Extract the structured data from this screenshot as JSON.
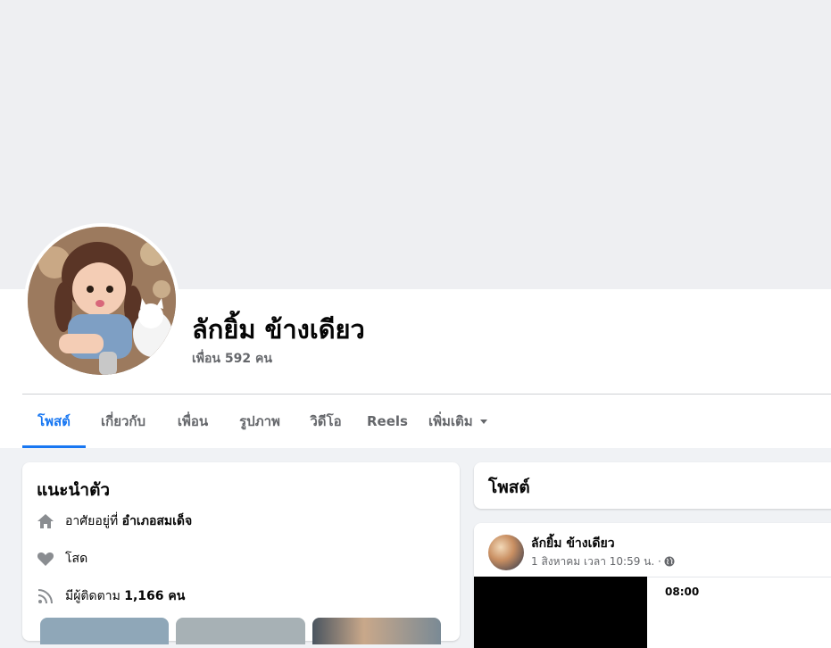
{
  "profile": {
    "name": "ลักยิ้ม ข้างเดียว",
    "friends": "เพื่อน 592 คน"
  },
  "tabs": [
    {
      "label": "โพสต์",
      "active": true
    },
    {
      "label": "เกี่ยวกับ",
      "active": false
    },
    {
      "label": "เพื่อน",
      "active": false
    },
    {
      "label": "รูปภาพ",
      "active": false
    },
    {
      "label": "วิดีโอ",
      "active": false
    },
    {
      "label": "Reels",
      "active": false
    },
    {
      "label": "เพิ่มเติม",
      "active": false
    }
  ],
  "intro": {
    "title": "แนะนำตัว",
    "lives_prefix": "อาศัยอยู่ที่",
    "lives_place": "อำเภอสมเด็จ",
    "relationship": "โสด",
    "followers_prefix": "มีผู้ติดตาม",
    "followers_count": "1,166 คน"
  },
  "posts": {
    "title": "โพสต์",
    "post": {
      "author": "ลักยิ้ม ข้างเดียว",
      "meta": "1 สิงหาคม เวลา 10:59 น. ·",
      "video_time": "08:00"
    }
  },
  "colors": {
    "accent": "#1877f2",
    "secondary_text": "#65676b",
    "background": "#f0f2f5"
  },
  "icons": {
    "home": "home-icon",
    "heart": "heart-icon",
    "rss": "followers-icon",
    "globe": "globe-icon",
    "caret": "caret-down-icon"
  }
}
